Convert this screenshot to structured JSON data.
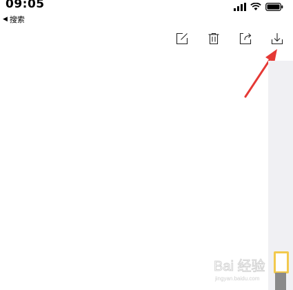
{
  "status_bar": {
    "time": "09:05",
    "back_label": "搜索",
    "signal_icon": "signal-icon",
    "wifi_icon": "wifi-icon",
    "battery_icon": "battery-icon"
  },
  "toolbar": {
    "items": [
      {
        "icon": "edit-icon"
      },
      {
        "icon": "trash-icon"
      },
      {
        "icon": "share-icon"
      },
      {
        "icon": "download-icon"
      }
    ]
  },
  "annotation": {
    "color": "#e53935"
  },
  "scrollbar": {
    "thumb_color": "#f2c94c"
  },
  "watermark": {
    "text": "Bai 经验",
    "subtext": "jingyan.baidu.com"
  }
}
